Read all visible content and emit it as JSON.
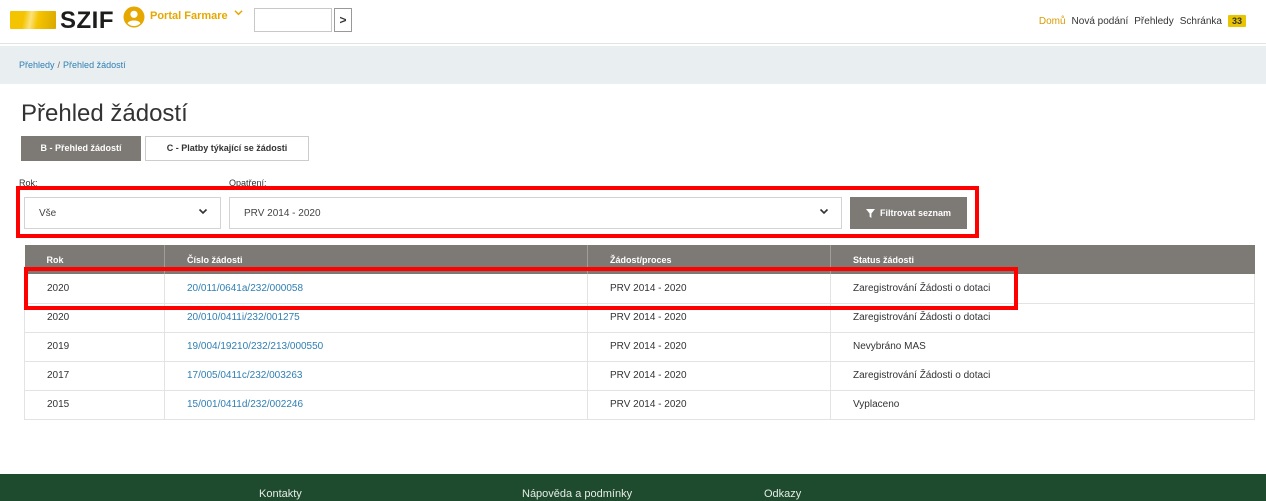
{
  "header": {
    "logo_text": "SZIF",
    "portal_title": "Portal Farmare",
    "search_value": "",
    "go_label": ">",
    "nav": {
      "home": "Domů",
      "new_submission": "Nová podání",
      "overviews": "Přehledy",
      "inbox": "Schránka",
      "inbox_count": "33"
    },
    "accent_color": "#e6a800"
  },
  "breadcrumb": {
    "item1": "Přehledy",
    "separator": "/",
    "item2": "Přehled žádostí"
  },
  "page": {
    "title": "Přehled žádostí"
  },
  "tabs": {
    "b": "B - Přehled žádostí",
    "c": "C - Platby týkající se žádosti"
  },
  "filters": {
    "rok_label": "Rok:",
    "rok_value": "Vše",
    "opatreni_label": "Opatření:",
    "opatreni_value": "PRV 2014 - 2020",
    "filter_button": "Filtrovat seznam",
    "filter_icon": "funnel-icon"
  },
  "table": {
    "headers": {
      "rok": "Rok",
      "cislo": "Číslo žádosti",
      "proces": "Žádost/proces",
      "status": "Status žádosti"
    },
    "rows": [
      {
        "rok": "2020",
        "cislo": "20/011/0641a/232/000058",
        "proces": "PRV 2014 - 2020",
        "status": "Zaregistrování Žádosti o dotaci"
      },
      {
        "rok": "2020",
        "cislo": "20/010/0411i/232/001275",
        "proces": "PRV 2014 - 2020",
        "status": "Zaregistrování Žádosti o dotaci"
      },
      {
        "rok": "2019",
        "cislo": "19/004/19210/232/213/000550",
        "proces": "PRV 2014 - 2020",
        "status": "Nevybráno MAS"
      },
      {
        "rok": "2017",
        "cislo": "17/005/0411c/232/003263",
        "proces": "PRV 2014 - 2020",
        "status": "Zaregistrování Žádosti o dotaci"
      },
      {
        "rok": "2015",
        "cislo": "15/001/0411d/232/002246",
        "proces": "PRV 2014 - 2020",
        "status": "Vyplaceno"
      }
    ]
  },
  "footer": {
    "contacts": "Kontakty",
    "help": "Nápověda a podmínky",
    "links": "Odkazy"
  },
  "colors": {
    "primary_gray": "#7d7974",
    "link_blue": "#2f7fb3",
    "highlight_red": "#ff0000",
    "footer_green": "#1e4a2d",
    "badge_yellow": "#e8c500"
  }
}
